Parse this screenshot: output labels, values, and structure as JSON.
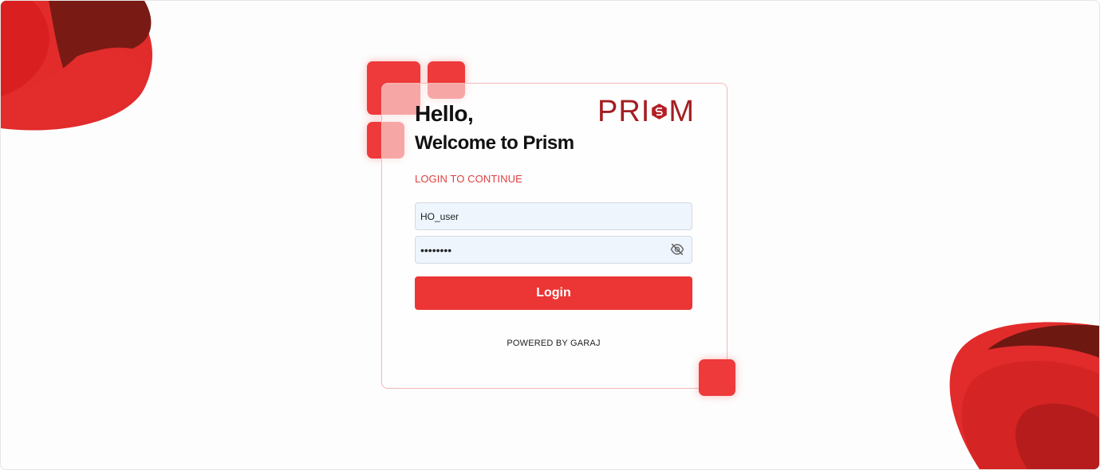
{
  "header": {
    "greeting": "Hello,",
    "welcome": "Welcome to Prism",
    "logo_text_left": "PRI",
    "logo_text_right": "M"
  },
  "form": {
    "subtitle": "LOGIN TO CONTINUE",
    "username_value": "HO_user",
    "password_value": "••••••••",
    "password_toggle_icon": "eye-off-icon",
    "login_label": "Login"
  },
  "footer": {
    "powered_by": "POWERED BY GARAJ"
  },
  "colors": {
    "accent": "#ee3a3a",
    "logo": "#a31e22",
    "subtitle": "#e04040",
    "input_bg": "#eef5fd"
  }
}
